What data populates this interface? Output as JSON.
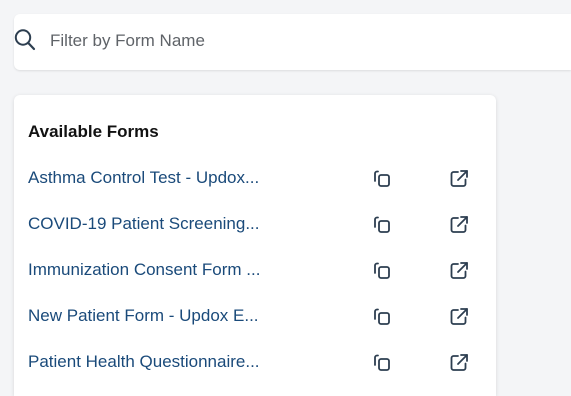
{
  "search": {
    "placeholder": "Filter by Form Name",
    "value": ""
  },
  "panel": {
    "title": "Available Forms"
  },
  "forms": [
    {
      "name": "Asthma Control Test - Updox..."
    },
    {
      "name": "COVID-19 Patient Screening..."
    },
    {
      "name": "Immunization Consent Form ..."
    },
    {
      "name": "New Patient Form - Updox E..."
    },
    {
      "name": "Patient Health Questionnaire..."
    }
  ],
  "icons": {
    "search": "search-icon",
    "copy": "copy-icon",
    "open": "external-link-icon"
  },
  "colors": {
    "link": "#1a4a7a",
    "icon": "#2d3e50",
    "background": "#f4f5f7"
  }
}
